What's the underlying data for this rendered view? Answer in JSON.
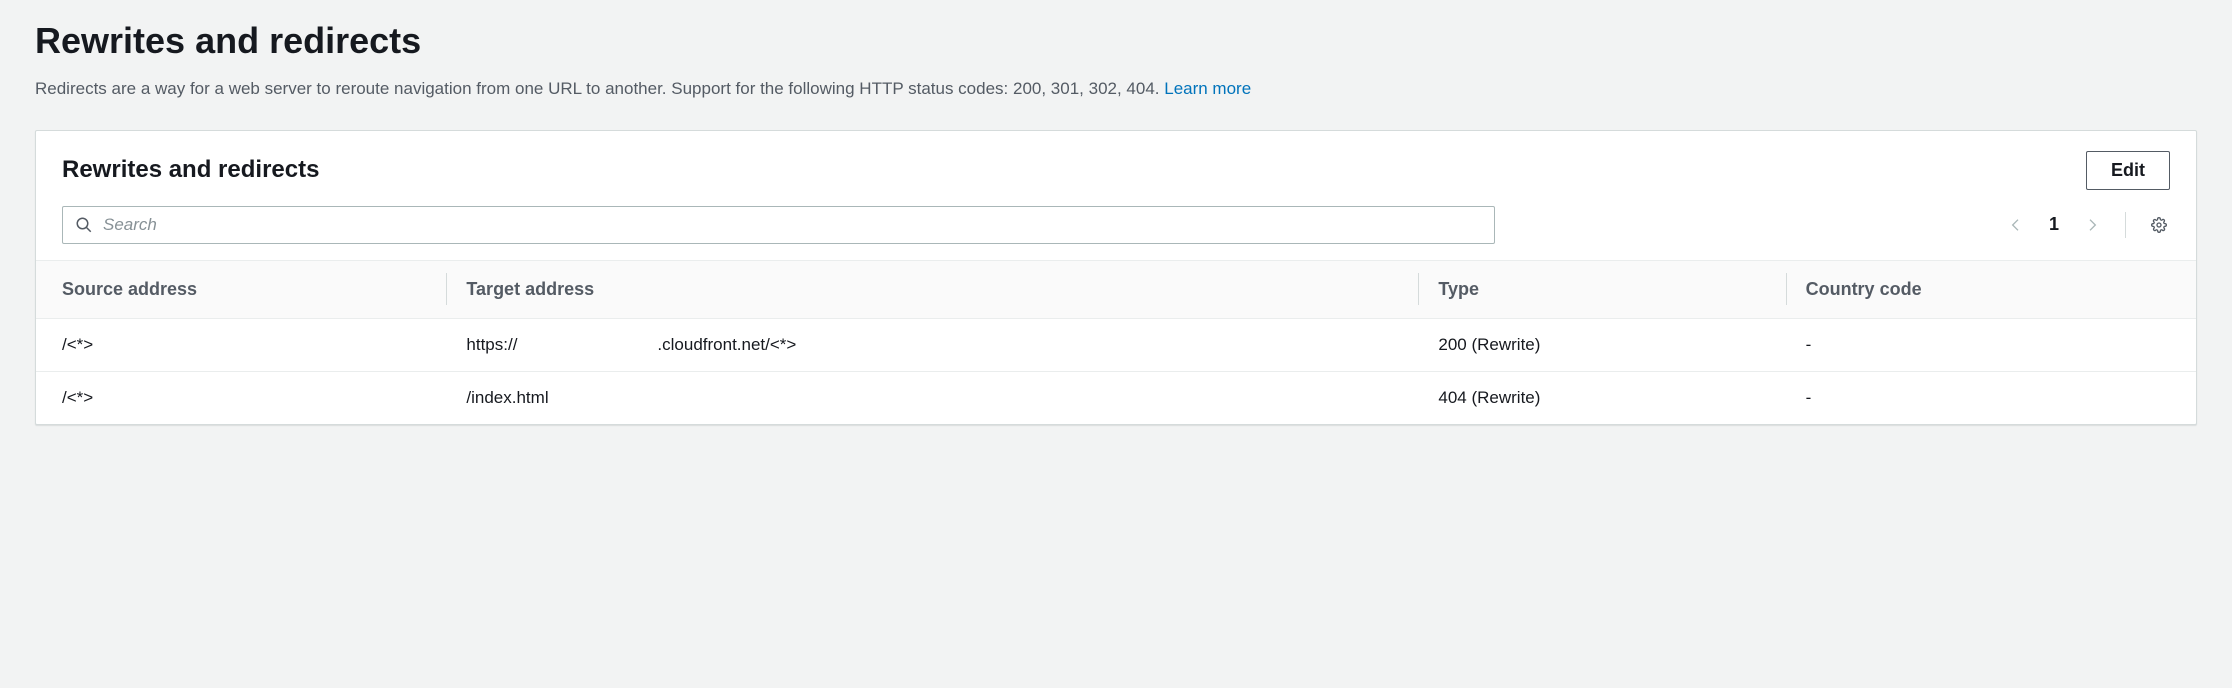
{
  "page": {
    "title": "Rewrites and redirects",
    "subtitle": "Redirects are a way for a web server to reroute navigation from one URL to another. Support for the following HTTP status codes: 200, 301, 302, 404. ",
    "learn_more": "Learn more"
  },
  "panel": {
    "title": "Rewrites and redirects",
    "edit_label": "Edit",
    "search_placeholder": "Search",
    "page_number": "1"
  },
  "table": {
    "headers": {
      "source": "Source address",
      "target": "Target address",
      "type": "Type",
      "country": "Country code"
    },
    "rows": [
      {
        "source": "/<*>",
        "target_prefix": "https://",
        "target_suffix": ".cloudfront.net/<*>",
        "type": "200 (Rewrite)",
        "country": "-"
      },
      {
        "source": "/<*>",
        "target_prefix": "/index.html",
        "target_suffix": "",
        "type": "404 (Rewrite)",
        "country": "-"
      }
    ]
  }
}
